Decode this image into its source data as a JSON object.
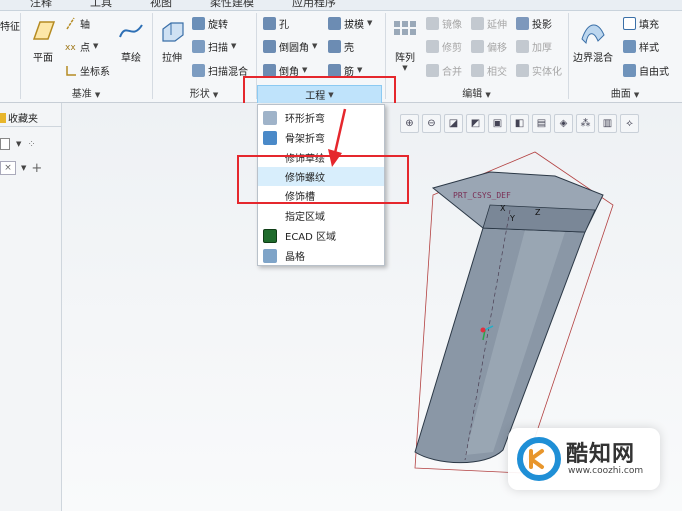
{
  "tabs": [
    "注释",
    "工具",
    "视图",
    "柔性建模",
    "应用程序"
  ],
  "ribbon": {
    "left_cut": "特征",
    "groups": {
      "datum": {
        "label": "基准",
        "plane": "平面",
        "axis": "轴",
        "point": "点",
        "coord": "坐标系",
        "sketch": "草绘"
      },
      "shape": {
        "label": "形状",
        "extrude": "拉伸",
        "revolve": "旋转",
        "sweep": "扫描",
        "sweep_blend": "扫描混合"
      },
      "engineering": {
        "label": "工程",
        "hole": "孔",
        "round": "倒圆角",
        "chamfer": "倒角",
        "draft": "拔模",
        "shell": "壳",
        "rib": "筋"
      },
      "editing": {
        "label": "编辑",
        "pattern": "阵列",
        "mirror": "镜像",
        "extend": "延伸",
        "project": "投影",
        "trim": "修剪",
        "offset": "偏移",
        "thicken": "加厚",
        "merge": "合并",
        "intersect": "相交",
        "solidify": "实体化"
      },
      "surfaces": {
        "label": "曲面",
        "boundary_blend": "边界混合",
        "fill": "填充",
        "style": "样式",
        "freestyle": "自由式"
      }
    }
  },
  "left_panel": {
    "favorites_tab": "收藏夹"
  },
  "menu": {
    "items": [
      "环形折弯",
      "骨架折弯",
      "修饰草绘",
      "修饰螺纹",
      "修饰槽",
      "指定区域",
      "ECAD 区域",
      "晶格"
    ]
  },
  "model": {
    "csys_label": "PRT_CSYS_DEF",
    "axis_x": "X",
    "axis_y": "Y",
    "axis_z": "Z"
  },
  "watermark": {
    "brand": "酷知网",
    "url": "www.coozhi.com"
  },
  "colors": {
    "highlight_box": "#e5272d",
    "menu_hover": "#d8eefc",
    "model_body": "#8a97a6"
  }
}
